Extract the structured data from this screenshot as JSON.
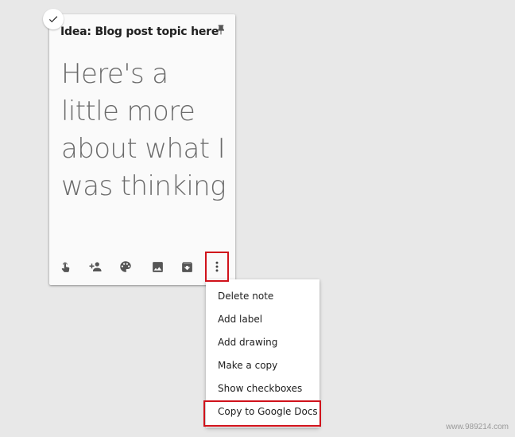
{
  "note": {
    "title": "Idea: Blog post topic here",
    "body": "Here's a little more about what I was thinking",
    "pinned": true
  },
  "toolbar": {
    "icons": [
      "remind-me-icon",
      "collaborator-icon",
      "palette-icon",
      "image-icon",
      "archive-icon",
      "more-vert-icon"
    ]
  },
  "menu": {
    "items": [
      {
        "label": "Delete note"
      },
      {
        "label": "Add label"
      },
      {
        "label": "Add drawing"
      },
      {
        "label": "Make a copy"
      },
      {
        "label": "Show checkboxes"
      },
      {
        "label": "Copy to Google Docs"
      }
    ]
  },
  "highlight_color": "#d0121b",
  "watermark": "www.989214.com"
}
